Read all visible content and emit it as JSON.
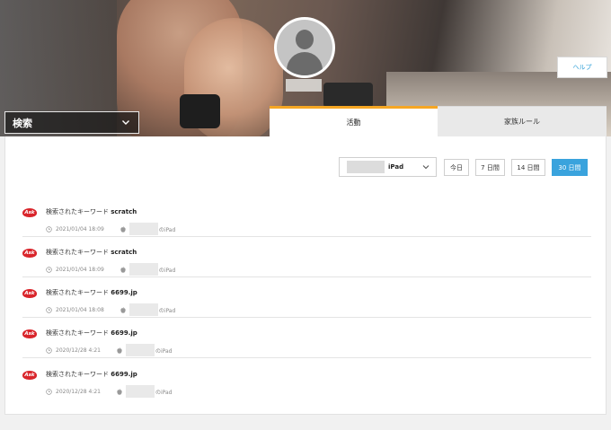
{
  "header": {
    "help_label": "ヘルプ",
    "category_label": "検索"
  },
  "tabs": [
    {
      "label": "活動",
      "active": true
    },
    {
      "label": "家族ルール",
      "active": false
    }
  ],
  "filters": {
    "device_label": "iPad",
    "ranges": [
      {
        "label": "今日",
        "active": false
      },
      {
        "label": "7 日間",
        "active": false
      },
      {
        "label": "14 日間",
        "active": false
      },
      {
        "label": "30 日間",
        "active": true
      }
    ]
  },
  "entries": [
    {
      "prefix": "検索されたキーワード",
      "keyword": "scratch",
      "time": "2021/01/04 18:09",
      "device": "のiPad"
    },
    {
      "prefix": "検索されたキーワード",
      "keyword": "scratch",
      "time": "2021/01/04 18:09",
      "device": "のiPad"
    },
    {
      "prefix": "検索されたキーワード",
      "keyword": "6699.jp",
      "time": "2021/01/04 18:08",
      "device": "のiPad"
    },
    {
      "prefix": "検索されたキーワード",
      "keyword": "6699.jp",
      "time": "2020/12/28 4:21",
      "device": "のiPad"
    },
    {
      "prefix": "検索されたキーワード",
      "keyword": "6699.jp",
      "time": "2020/12/28 4:21",
      "device": "のiPad"
    }
  ],
  "logo_text": "Ask",
  "colors": {
    "accent": "#3aa3dd",
    "tab_active_border": "#f5a623",
    "ask_red": "#d9252b"
  }
}
